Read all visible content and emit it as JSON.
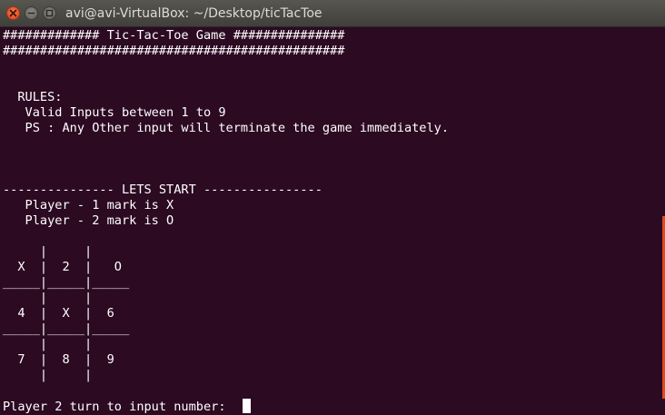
{
  "window": {
    "title": "avi@avi-VirtualBox: ~/Desktop/ticTacToe"
  },
  "terminal": {
    "lines": [
      "############# Tic-Tac-Toe Game ###############",
      "##############################################",
      "",
      "",
      "  RULES:",
      "   Valid Inputs between 1 to 9",
      "   PS : Any Other input will terminate the game immediately.",
      "",
      "",
      "",
      "--------------- LETS START ----------------",
      "   Player - 1 mark is X",
      "   Player - 2 mark is O",
      "",
      "     |     |",
      "  X  |  2  |   O",
      "_____|_____|_____",
      "     |     |",
      "  4  |  X  |  6",
      "_____|_____|_____",
      "     |     |",
      "  7  |  8  |  9",
      "     |     |",
      "",
      "Player 2 turn to input number:  "
    ]
  }
}
